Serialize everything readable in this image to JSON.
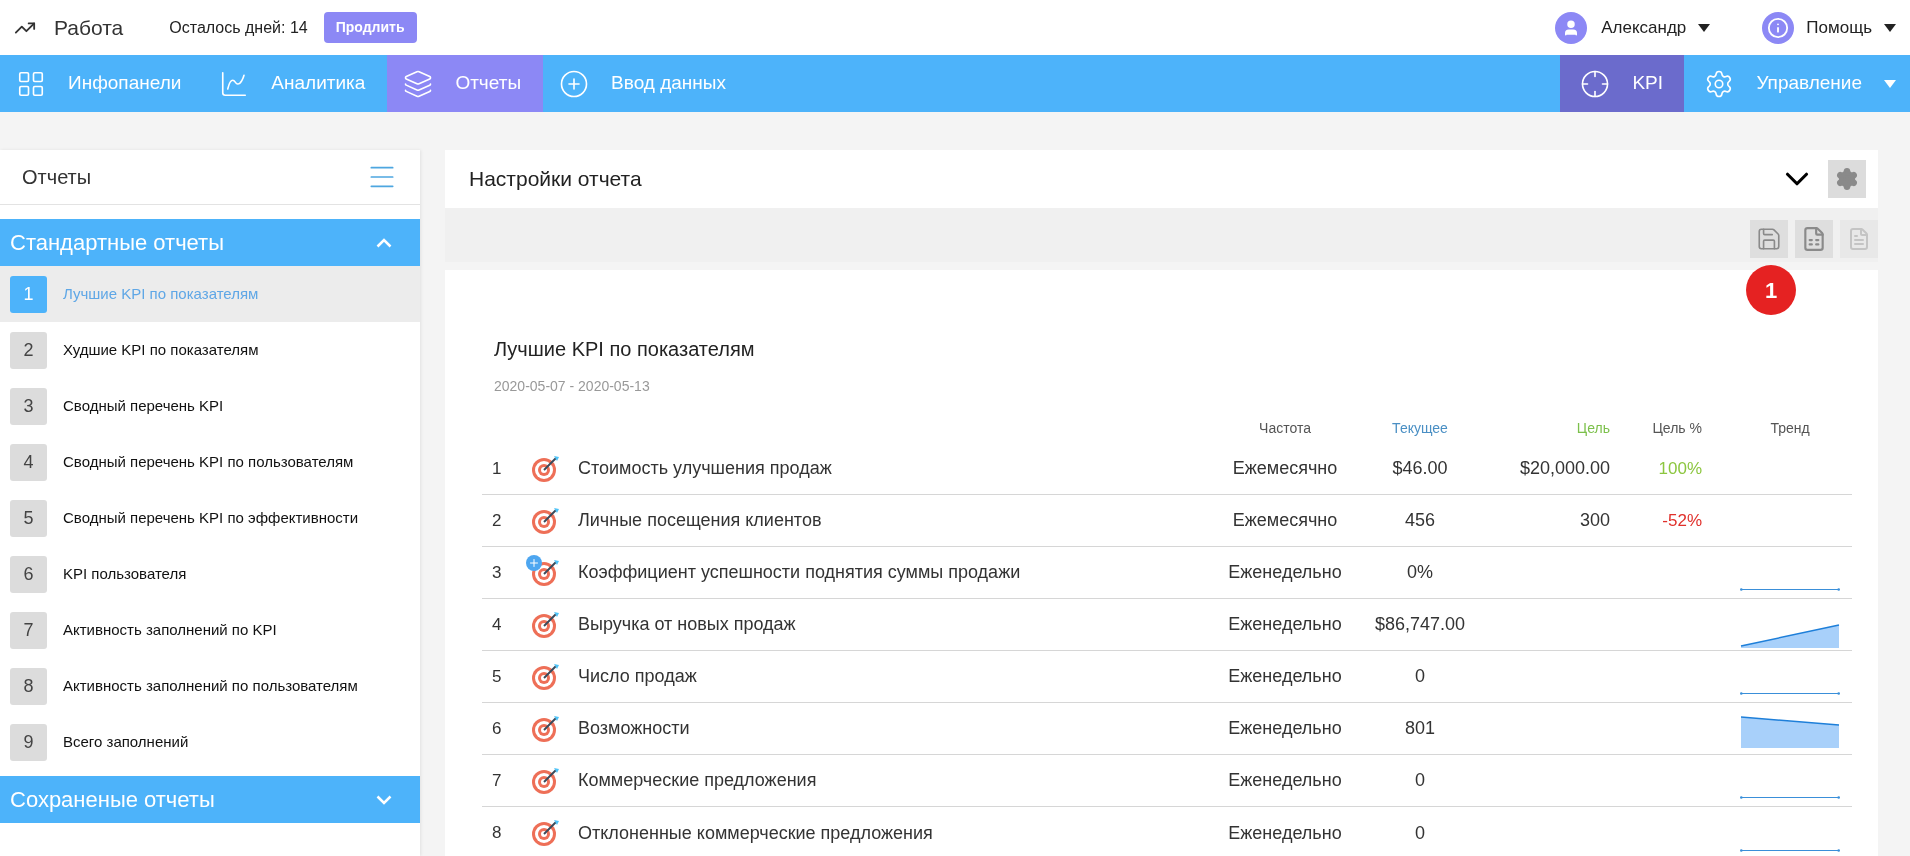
{
  "header": {
    "app_title": "Работа",
    "trial_text": "Осталось дней: 14",
    "extend_button": "Продлить",
    "user": "Александр",
    "help": "Помощь"
  },
  "nav": {
    "items": [
      {
        "label": "Инфопанели",
        "selected": false
      },
      {
        "label": "Аналитика",
        "selected": false
      },
      {
        "label": "Отчеты",
        "selected": true
      },
      {
        "label": "Ввод данных",
        "selected": false
      }
    ],
    "right_items": [
      {
        "label": "KPI",
        "selected": true,
        "dropdown": false
      },
      {
        "label": "Управление",
        "selected": false,
        "dropdown": true
      }
    ]
  },
  "sidebar": {
    "title": "Отчеты",
    "sections": [
      {
        "title": "Стандартные отчеты",
        "expanded": true,
        "items": [
          {
            "number": "1",
            "label": "Лучшие KPI по показателям",
            "selected": true
          },
          {
            "number": "2",
            "label": "Худшие KPI по показателям",
            "selected": false
          },
          {
            "number": "3",
            "label": "Сводный перечень KPI",
            "selected": false
          },
          {
            "number": "4",
            "label": "Сводный перечень KPI по пользователям",
            "selected": false
          },
          {
            "number": "5",
            "label": "Сводный перечень KPI по эффективности",
            "selected": false
          },
          {
            "number": "6",
            "label": "KPI пользователя",
            "selected": false
          },
          {
            "number": "7",
            "label": "Активность заполнений по KPI",
            "selected": false
          },
          {
            "number": "8",
            "label": "Активность заполнений по пользователям",
            "selected": false
          },
          {
            "number": "9",
            "label": "Всего заполнений",
            "selected": false
          }
        ]
      },
      {
        "title": "Сохраненые отчеты",
        "expanded": false
      }
    ]
  },
  "settings": {
    "title": "Настройки отчета",
    "expanded": false,
    "save_badge": "1"
  },
  "report": {
    "title": "Лучшие KPI по показателям",
    "period": "2020-05-07 - 2020-05-13",
    "columns": [
      {
        "label": "Частота",
        "color": "#555555"
      },
      {
        "label": "Текущее",
        "color": "#4a8fc4"
      },
      {
        "label": "Цель",
        "color": "#7cc04b"
      },
      {
        "label": "Цель %",
        "color": "#555555"
      },
      {
        "label": "Тренд",
        "color": "#555555"
      }
    ],
    "rows": [
      {
        "number": "1",
        "name": "Стоимость улучшения продаж",
        "plus_badge": false,
        "frequency": "Ежемесячно",
        "current": "$46.00",
        "target": "$20,000.00",
        "target_pct": "100%",
        "color": "#8cc63f"
      },
      {
        "number": "2",
        "name": "Личные посещения клиентов",
        "plus_badge": false,
        "frequency": "Ежемесячно",
        "current": "456",
        "target": "300",
        "target_pct": "-52%",
        "color": "#e0302b"
      },
      {
        "number": "3",
        "name": "Коэффициент успешности поднятия суммы продажи",
        "plus_badge": true,
        "frequency": "Еженедельно",
        "current": "0%",
        "trend": {
          "kind": "flat"
        }
      },
      {
        "number": "4",
        "name": "Выручка от новых продаж",
        "plus_badge": false,
        "frequency": "Еженедельно",
        "current": "$86,747.00",
        "trend": {
          "kind": "up"
        }
      },
      {
        "number": "5",
        "name": "Число продаж",
        "plus_badge": false,
        "frequency": "Еженедельно",
        "current": "0",
        "trend": {
          "kind": "flat"
        }
      },
      {
        "number": "6",
        "name": "Возможности",
        "plus_badge": false,
        "frequency": "Еженедельно",
        "current": "801",
        "trend": {
          "kind": "down"
        }
      },
      {
        "number": "7",
        "name": "Коммерческие предложения",
        "plus_badge": false,
        "frequency": "Еженедельно",
        "current": "0",
        "trend": {
          "kind": "flat"
        }
      },
      {
        "number": "8",
        "name": "Отклоненные коммерческие предложения",
        "plus_badge": false,
        "frequency": "Еженедельно",
        "current": "0",
        "trend": {
          "kind": "flat"
        }
      }
    ]
  }
}
